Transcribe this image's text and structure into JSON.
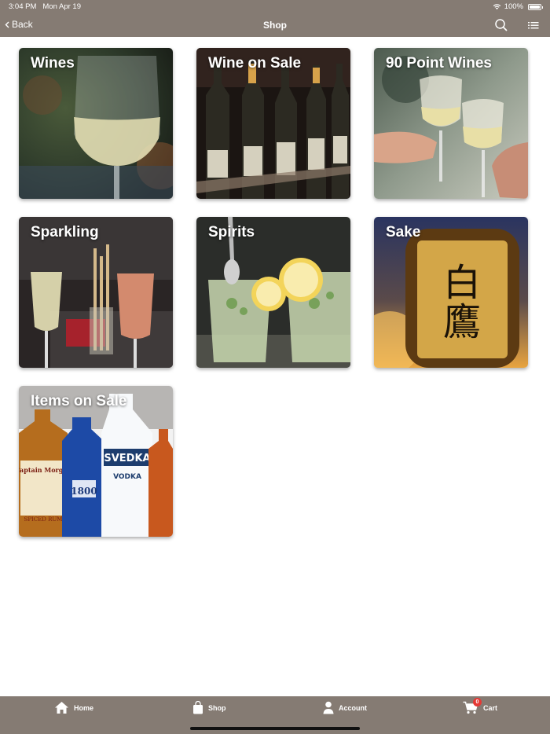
{
  "status_bar": {
    "time": "3:04 PM",
    "date": "Mon Apr 19",
    "battery": "100%"
  },
  "nav": {
    "back_label": "Back",
    "title": "Shop"
  },
  "categories": [
    {
      "label": "Wines"
    },
    {
      "label": "Wine on Sale"
    },
    {
      "label": "90 Point Wines"
    },
    {
      "label": "Sparkling"
    },
    {
      "label": "Spirits"
    },
    {
      "label": "Sake"
    },
    {
      "label": "Items on Sale"
    }
  ],
  "tab_bar": {
    "home": "Home",
    "shop": "Shop",
    "account": "Account",
    "cart": "Cart",
    "cart_count": "0"
  },
  "colors": {
    "bar": "#857b73",
    "badge": "#e53935"
  }
}
